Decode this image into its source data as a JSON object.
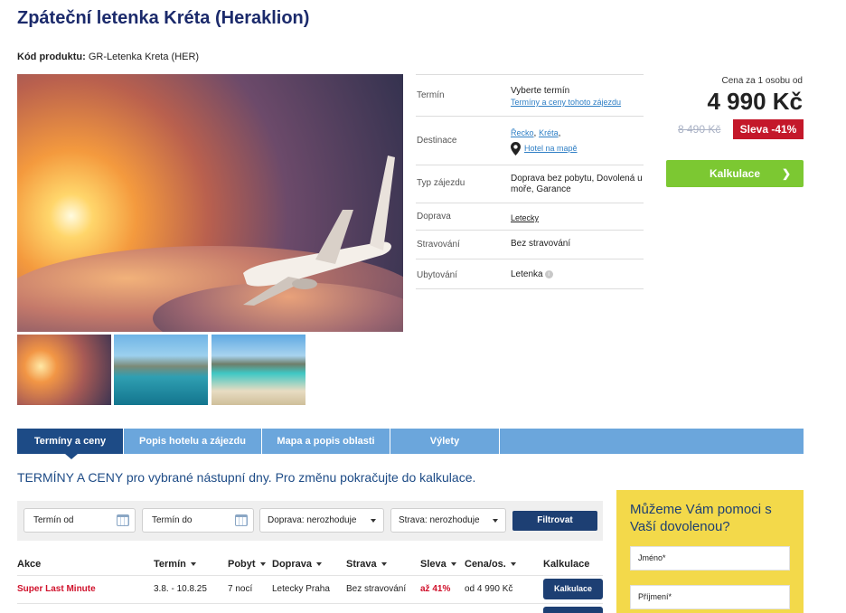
{
  "title": "Zpáteční letenka Kréta (Heraklion)",
  "product_code_label": "Kód produktu:",
  "product_code": "GR-Letenka Kreta (HER)",
  "info": {
    "termin_label": "Termín",
    "termin_value": "Vyberte termín",
    "termin_link": "Termíny a ceny tohoto zájezdu",
    "destinace_label": "Destinace",
    "destinace_link1": "Řecko",
    "destinace_link2": "Kréta",
    "destinace_map": "Hotel na mapě",
    "typ_label": "Typ zájezdu",
    "typ_value": "Doprava bez pobytu, Dovolená u moře, Garance",
    "doprava_label": "Doprava",
    "doprava_value": "Letecky",
    "stravovani_label": "Stravování",
    "stravovani_value": "Bez stravování",
    "ubytovani_label": "Ubytování",
    "ubytovani_value": "Letenka"
  },
  "price": {
    "label": "Cena za 1 osobu od",
    "current": "4 990 Kč",
    "old": "8 490 Kč",
    "discount": "Sleva -41%",
    "button": "Kalkulace"
  },
  "tabs": [
    "Termíny a ceny",
    "Popis hotelu a zájezdu",
    "Mapa a popis oblasti",
    "Výlety"
  ],
  "section_intro": "TERMÍNY A CENY pro vybrané nástupní dny. Pro změnu pokračujte do kalkulace.",
  "filters": {
    "date_from": "Termín od",
    "date_to": "Termín do",
    "doprava": "Doprava: nerozhoduje",
    "strava": "Strava: nerozhoduje",
    "button": "Filtrovat"
  },
  "table": {
    "headers": [
      "Akce",
      "Termín",
      "Pobyt",
      "Doprava",
      "Strava",
      "Sleva",
      "Cena/os.",
      "Kalkulace"
    ],
    "rows": [
      {
        "akce": "Super Last Minute",
        "termin": "3.8. - 10.8.25",
        "pobyt": "7 nocí",
        "doprava": "Letecky Praha",
        "strava": "Bez stravování",
        "sleva": "až 41%",
        "cena": "od 4 990 Kč",
        "button": "Kalkulace"
      }
    ]
  },
  "help": {
    "title": "Můžeme Vám pomoci s Vaší dovolenou?",
    "name_placeholder": "Jméno*",
    "surname_placeholder": "Příjmení*"
  },
  "colors": {
    "title": "#1b2a6b",
    "tab_active": "#1d4b86",
    "tab_bar": "#6ba6dc",
    "calc_button": "#7cc832",
    "discount": "#c4182a",
    "help_box": "#f3d94a"
  }
}
